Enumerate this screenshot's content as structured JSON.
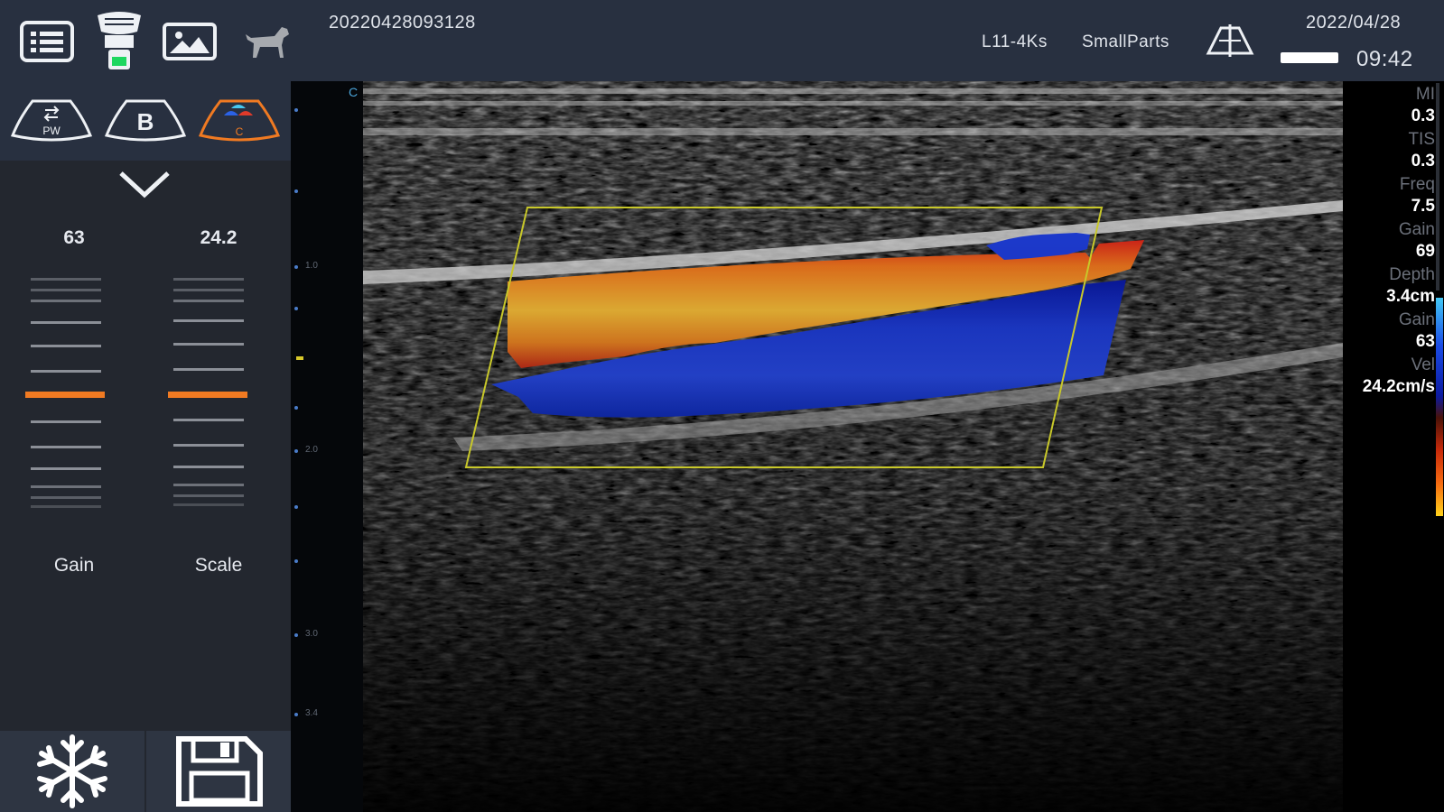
{
  "header": {
    "patient_id": "20220428093128",
    "probe": "L11-4Ks",
    "preset": "SmallParts",
    "date": "2022/04/28",
    "time": "09:42",
    "icons": [
      "menu-list-icon",
      "probe-icon",
      "image-gallery-icon",
      "dog-icon",
      "probe-shape-icon",
      "battery-icon"
    ],
    "probe_status_color": "#1ed760"
  },
  "modes": [
    {
      "name": "PW",
      "active": false
    },
    {
      "name": "B",
      "active": false
    },
    {
      "name": "C",
      "active": true
    }
  ],
  "controls": {
    "gain": {
      "label": "Gain",
      "value": "63"
    },
    "scale": {
      "label": "Scale",
      "value": "24.2"
    }
  },
  "bottom_buttons": {
    "freeze_icon": "snowflake-icon",
    "save_icon": "save-icon"
  },
  "depth_ruler": {
    "marker": "C",
    "ticks": [
      "1.0",
      "2.0",
      "3.0",
      "3.4"
    ]
  },
  "params": [
    {
      "label": "MI",
      "value": "0.3"
    },
    {
      "label": "TIS",
      "value": "0.3"
    },
    {
      "label": "Freq",
      "value": "7.5"
    },
    {
      "label": "Gain",
      "value": "69"
    },
    {
      "label": "Depth",
      "value": "3.4cm"
    },
    {
      "label": "Gain",
      "value": "63"
    },
    {
      "label": "Vel",
      "value": "24.2cm/s"
    }
  ],
  "colors": {
    "accent": "#f07a22",
    "panel": "#23272f",
    "topbar": "#283040",
    "roi_box": "#c8c82a",
    "flow_toward": "#f5781e",
    "flow_away": "#1f3fe0"
  }
}
